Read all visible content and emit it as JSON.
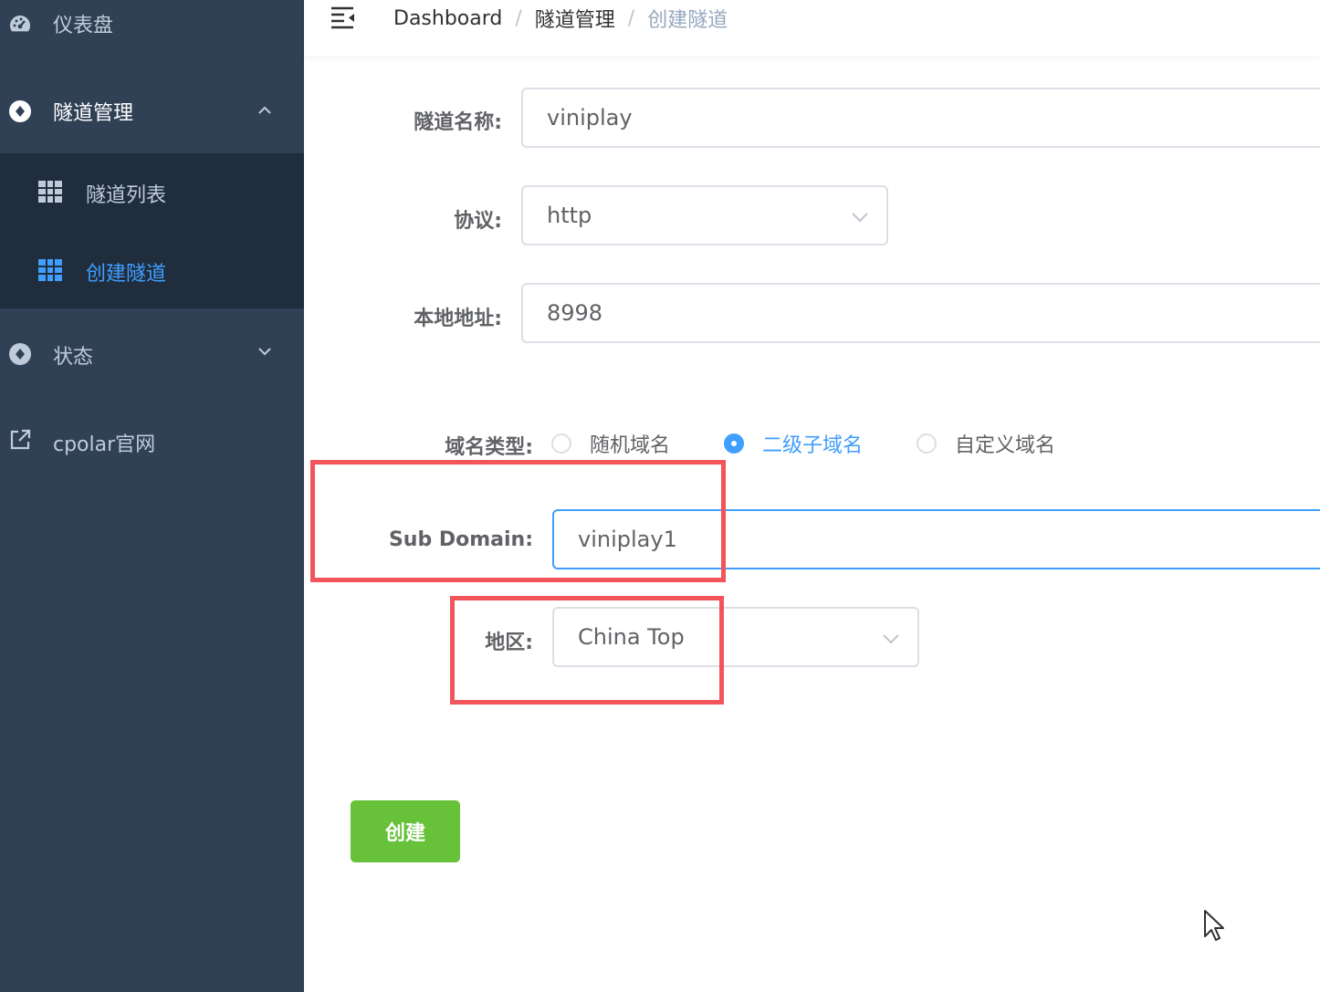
{
  "sidebar": {
    "items": [
      {
        "label": "仪表盘",
        "icon": "dashboard-gauge-icon"
      },
      {
        "label": "隧道管理",
        "icon": "tunnel-management-icon",
        "expanded": true
      },
      {
        "label": "状态",
        "icon": "status-icon",
        "expanded": false
      },
      {
        "label": "cpolar官网",
        "icon": "external-link-icon"
      }
    ],
    "submenu": [
      {
        "label": "隧道列表",
        "icon": "table-grid-icon"
      },
      {
        "label": "创建隧道",
        "icon": "table-grid-icon",
        "active": true
      }
    ],
    "colors": {
      "background": "#304156",
      "submenu_background": "#1f2d3d",
      "active": "#409eff"
    }
  },
  "header": {
    "breadcrumb": [
      "Dashboard",
      "隧道管理",
      "创建隧道"
    ],
    "separator": "/"
  },
  "form": {
    "tunnel_name": {
      "label": "隧道名称:",
      "value": "viniplay"
    },
    "protocol": {
      "label": "协议:",
      "value": "http"
    },
    "local_address": {
      "label": "本地地址:",
      "value": "8998"
    },
    "domain_type": {
      "label": "域名类型:",
      "options": [
        "随机域名",
        "二级子域名",
        "自定义域名"
      ],
      "selected": "二级子域名"
    },
    "sub_domain": {
      "label": "Sub Domain:",
      "value": "viniplay1"
    },
    "region": {
      "label": "地区:",
      "value": "China Top"
    },
    "submit_label": "创建"
  },
  "colors": {
    "primary": "#409eff",
    "success": "#67c23a",
    "highlight": "#f2545b"
  }
}
